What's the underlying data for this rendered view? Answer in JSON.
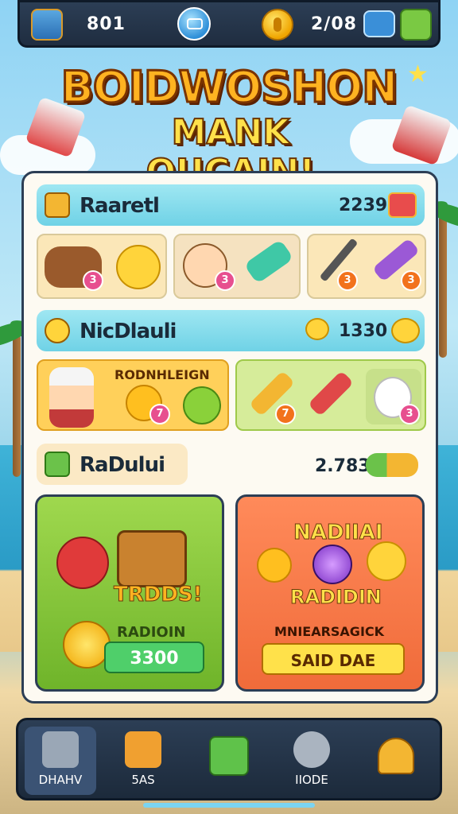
{
  "top_bar": {
    "currency_a": "801",
    "currency_b": "2/08"
  },
  "title": {
    "line1": "BOIDWOSHON",
    "line2": "MANK QUCAIN!"
  },
  "sections": [
    {
      "label": "Raaretl",
      "value": "2239"
    },
    {
      "label": "NicDlauli",
      "value": "1330",
      "banner": "RODNHLEIGN"
    },
    {
      "label": "RaDului",
      "value": "2.783"
    }
  ],
  "badges": {
    "row1": [
      "3",
      "3",
      "3",
      "3"
    ],
    "row2": [
      "7",
      "7",
      "3"
    ]
  },
  "cards": {
    "left": {
      "title": "TRDDS!",
      "subtitle": "RADIOIN",
      "button": "3300"
    },
    "right": {
      "title": "NADIIAI",
      "subtitle": "RADIDIN",
      "caption": "MNIEARSAGICK",
      "button": "SAID DAE"
    }
  },
  "bottom_nav": [
    {
      "label": "DHAHV",
      "icon": "hammer-icon"
    },
    {
      "label": "5AS",
      "icon": "tools-icon"
    },
    {
      "label": "",
      "icon": "box-icon"
    },
    {
      "label": "IIODE",
      "icon": "gear-icon"
    },
    {
      "label": "",
      "icon": "bell-icon"
    }
  ]
}
